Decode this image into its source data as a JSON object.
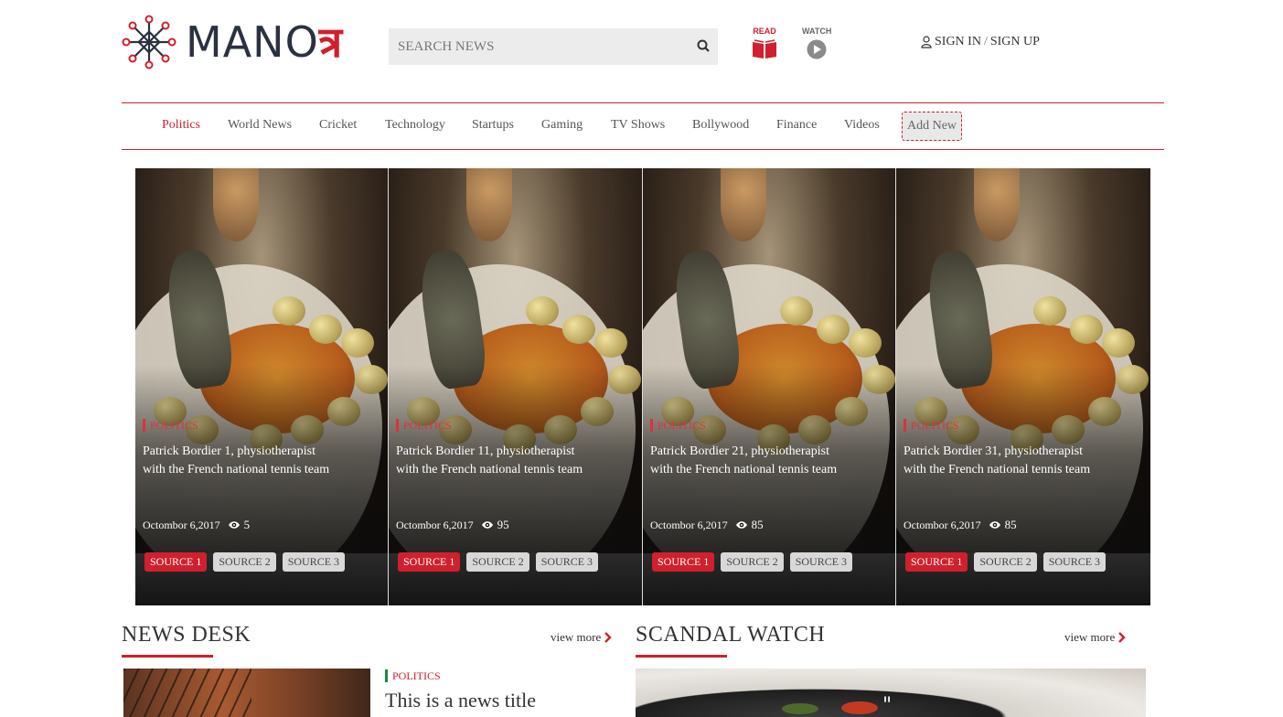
{
  "header": {
    "logo_text": "MANO",
    "logo_glyph": "त्र",
    "search_placeholder": "SEARCH NEWS",
    "read_label": "READ",
    "watch_label": "WATCH",
    "sign_in": "SIGN IN",
    "separator": "/",
    "sign_up": "SIGN UP"
  },
  "nav": {
    "items": [
      "Politics",
      "World News",
      "Cricket",
      "Technology",
      "Startups",
      "Gaming",
      "TV Shows",
      "Bollywood",
      "Finance",
      "Videos"
    ],
    "active": "Politics",
    "add_new": "Add New"
  },
  "slider": {
    "cards": [
      {
        "category": "POLITICS",
        "title": "Patrick Bordier 1, physiotherapist with the French national tennis team",
        "date": "Octombor 6,2017",
        "views": "5",
        "sources": [
          "SOURCE 1",
          "SOURCE 2",
          "SOURCE 3"
        ]
      },
      {
        "category": "POLITICS",
        "title": "Patrick Bordier 11, physiotherapist with the French national tennis team",
        "date": "Octombor 6,2017",
        "views": "95",
        "sources": [
          "SOURCE 1",
          "SOURCE 2",
          "SOURCE 3"
        ]
      },
      {
        "category": "POLITICS",
        "title": "Patrick Bordier 21, physiotherapist with the French national tennis team",
        "date": "Octombor 6,2017",
        "views": "85",
        "sources": [
          "SOURCE 1",
          "SOURCE 2",
          "SOURCE 3"
        ]
      },
      {
        "category": "POLITICS",
        "title": "Patrick Bordier 31, physiotherapist with the French national tennis team",
        "date": "Octombor 6,2017",
        "views": "85",
        "sources": [
          "SOURCE 1",
          "SOURCE 2",
          "SOURCE 3"
        ]
      }
    ]
  },
  "news_desk": {
    "title": "NEWS DESK",
    "view_more": "view more",
    "item_category": "POLITICS",
    "item_title": "This is a news title"
  },
  "scandal_watch": {
    "title": "SCANDAL WATCH",
    "view_more": "view more",
    "quote_mark": "\""
  },
  "colors": {
    "accent": "#d0202e",
    "nav_text": "#555555",
    "source_inactive": "#d8d8d8"
  },
  "icons": [
    "network-logo-icon",
    "search-icon",
    "book-icon",
    "play-icon",
    "user-icon",
    "eye-icon",
    "chevron-right-icon"
  ]
}
